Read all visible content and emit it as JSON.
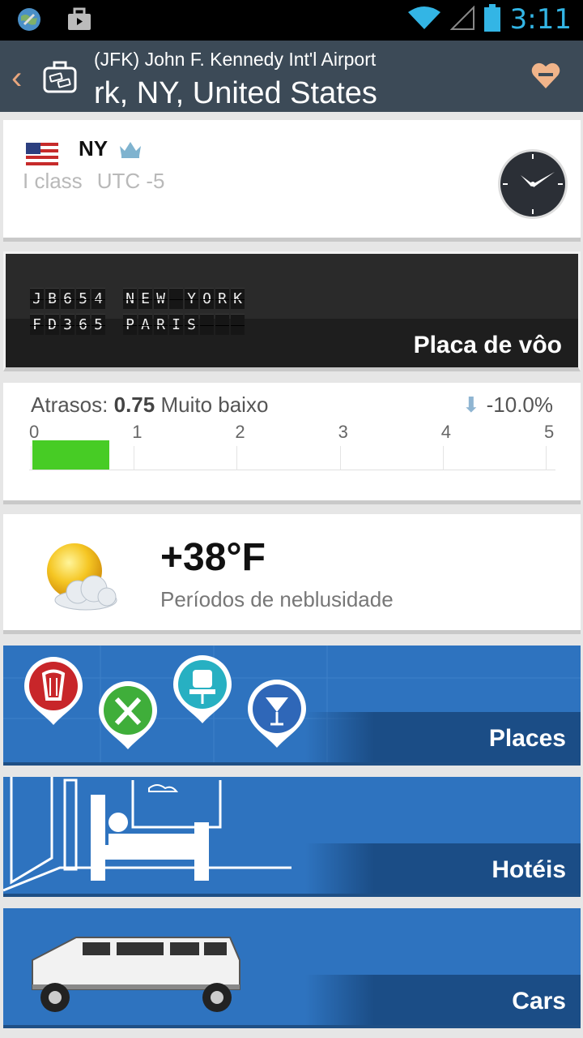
{
  "status_bar": {
    "time": "3:11",
    "icons": [
      "app-globe-icon",
      "briefcase-notification-icon",
      "wifi-icon",
      "signal-icon",
      "battery-icon"
    ]
  },
  "header": {
    "subtitle": "(JFK) John F. Kennedy Int'l Airport",
    "title": "rk, NY, United States",
    "back_icon": "chevron-left-icon",
    "badge_icon": "luggage-icon",
    "favorite_icon": "heart-remove-icon"
  },
  "city": {
    "code": "NY",
    "class": "I class",
    "utc": "UTC -5",
    "flag_icon": "us-flag-icon",
    "crown_icon": "crown-icon",
    "clock_icon": "clock-icon"
  },
  "flight_board": {
    "rows": [
      {
        "flight": "JB654",
        "destination": "NEW YORK"
      },
      {
        "flight": "FD365",
        "destination": "PARIS"
      }
    ],
    "label": "Placa de vôo"
  },
  "delays": {
    "label": "Atrasos:",
    "value": "0.75",
    "rating": "Muito baixo",
    "trend": "-10.0%",
    "trend_icon": "arrow-down-icon",
    "scale": [
      "0",
      "1",
      "2",
      "3",
      "4",
      "5"
    ],
    "bar_value": 0.75,
    "bar_color": "#47cc25"
  },
  "weather": {
    "temperature": "+38°F",
    "description": "Períodos de neblusidade",
    "icon": "sun-cloud-icon"
  },
  "tiles": {
    "places": "Places",
    "hotels": "Hotéis",
    "cars": "Cars"
  },
  "colors": {
    "header_bg": "#3c4a57",
    "accent": "#e9a67d",
    "tile_blue": "#2e73bf",
    "status_blue": "#33b5e5"
  }
}
